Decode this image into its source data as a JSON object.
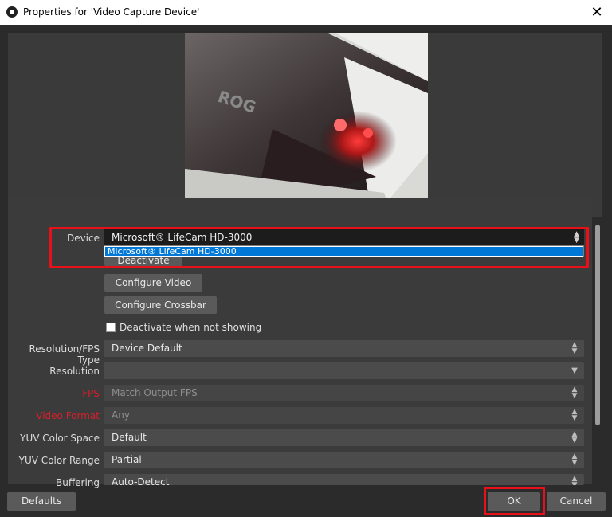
{
  "window": {
    "title": "Properties for 'Video Capture Device'",
    "close_label": "✕"
  },
  "device": {
    "label": "Device",
    "value": "Microsoft® LifeCam HD-3000",
    "dropdown_selected": "Microsoft® LifeCam HD-3000"
  },
  "buttons": {
    "deactivate": "Deactivate",
    "configure_video": "Configure Video",
    "configure_crossbar": "Configure Crossbar",
    "defaults": "Defaults",
    "ok": "OK",
    "cancel": "Cancel"
  },
  "checkbox": {
    "label": "Deactivate when not showing",
    "checked": false
  },
  "fields": [
    {
      "label": "Resolution/FPS Type",
      "value": "Device Default",
      "label_color": "normal",
      "dim": false,
      "arrow": "updown"
    },
    {
      "label": "Resolution",
      "value": "",
      "label_color": "normal",
      "dim": false,
      "arrow": "down"
    },
    {
      "label": "FPS",
      "value": "Match Output FPS",
      "label_color": "red",
      "dim": true,
      "arrow": "updown"
    },
    {
      "label": "Video Format",
      "value": "Any",
      "label_color": "red",
      "dim": true,
      "arrow": "updown"
    },
    {
      "label": "YUV Color Space",
      "value": "Default",
      "label_color": "normal",
      "dim": false,
      "arrow": "updown"
    },
    {
      "label": "YUV Color Range",
      "value": "Partial",
      "label_color": "normal",
      "dim": false,
      "arrow": "updown"
    },
    {
      "label": "Buffering",
      "value": "Auto-Detect",
      "label_color": "normal",
      "dim": false,
      "arrow": "updown"
    }
  ],
  "colors": {
    "highlight": "#e8111a",
    "selection": "#0078d7",
    "red_label": "#d6202a"
  }
}
